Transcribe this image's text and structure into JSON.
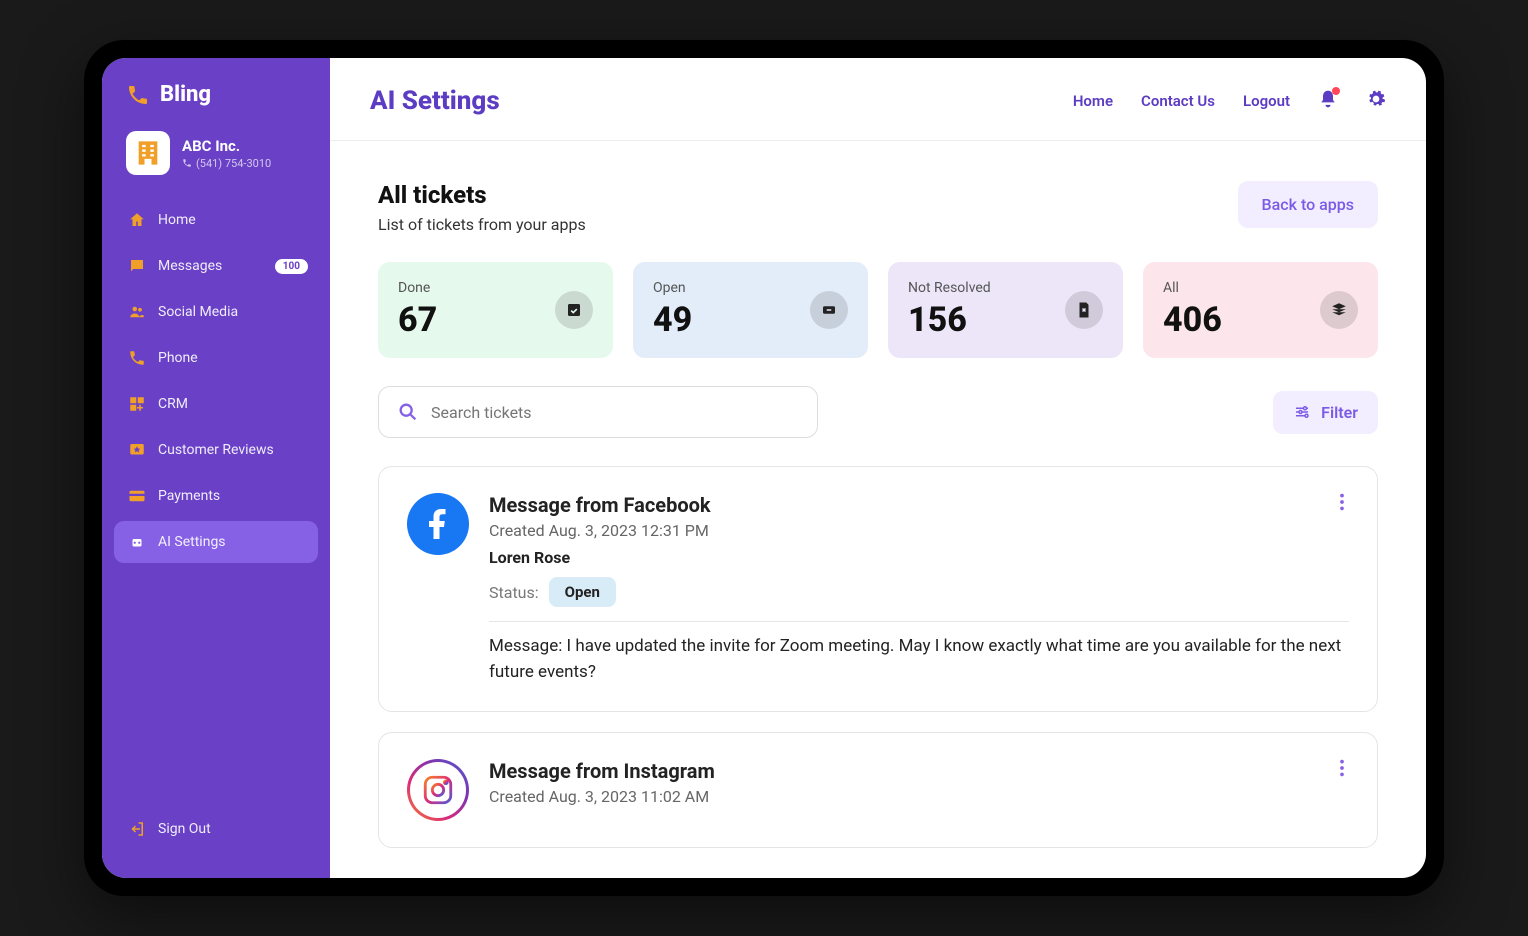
{
  "brand": {
    "name": "Bling"
  },
  "company": {
    "name": "ABC Inc.",
    "phone": "(541) 754-3010"
  },
  "sidebar": {
    "items": [
      {
        "label": "Home"
      },
      {
        "label": "Messages",
        "badge": "100"
      },
      {
        "label": "Social Media"
      },
      {
        "label": "Phone"
      },
      {
        "label": "CRM"
      },
      {
        "label": "Customer Reviews"
      },
      {
        "label": "Payments"
      },
      {
        "label": "AI Settings"
      }
    ],
    "signout": "Sign Out"
  },
  "header": {
    "title": "AI Settings",
    "links": {
      "home": "Home",
      "contact": "Contact Us",
      "logout": "Logout"
    }
  },
  "content": {
    "title": "All tickets",
    "subtitle": "List of tickets from your apps",
    "back": "Back to apps",
    "search_placeholder": "Search tickets",
    "filter": "Filter"
  },
  "stats": {
    "done": {
      "label": "Done",
      "value": "67"
    },
    "open": {
      "label": "Open",
      "value": "49"
    },
    "notres": {
      "label": "Not Resolved",
      "value": "156"
    },
    "all": {
      "label": "All",
      "value": "406"
    }
  },
  "tickets": [
    {
      "title": "Message from Facebook",
      "created": "Created Aug. 3, 2023 12:31 PM",
      "author": "Loren Rose",
      "status_label": "Status:",
      "status": "Open",
      "message": "Message: I have updated the invite for Zoom meeting. May I know exactly what time are you available for the next future events?"
    },
    {
      "title": "Message from Instagram",
      "created": "Created Aug. 3, 2023 11:02 AM"
    }
  ]
}
